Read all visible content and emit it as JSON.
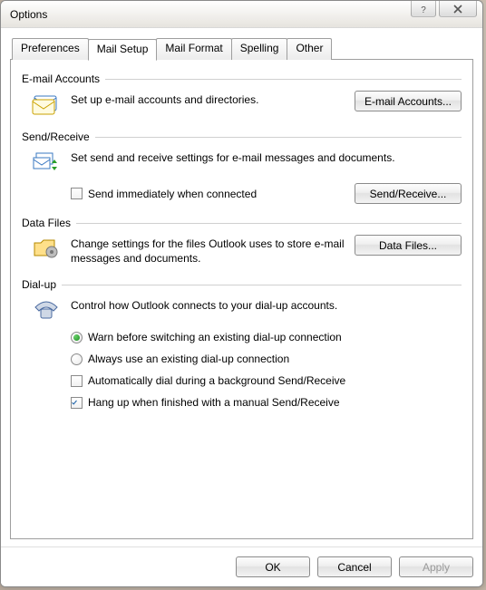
{
  "window": {
    "title": "Options"
  },
  "tabs": {
    "preferences": "Preferences",
    "mailsetup": "Mail Setup",
    "mailformat": "Mail Format",
    "spelling": "Spelling",
    "other": "Other"
  },
  "groups": {
    "email": {
      "title": "E-mail Accounts",
      "text": "Set up e-mail accounts and directories.",
      "button": "E-mail Accounts..."
    },
    "sendrecv": {
      "title": "Send/Receive",
      "text": "Set send and receive settings for e-mail messages and documents.",
      "check_immediate": "Send immediately when connected",
      "button": "Send/Receive..."
    },
    "datafiles": {
      "title": "Data Files",
      "text": "Change settings for the files Outlook uses to store e-mail messages and documents.",
      "button": "Data Files..."
    },
    "dialup": {
      "title": "Dial-up",
      "text": "Control how Outlook connects to your dial-up accounts.",
      "radio_warn": "Warn before switching an existing dial-up connection",
      "radio_always": "Always use an existing dial-up connection",
      "check_autodial": "Automatically dial during a background Send/Receive",
      "check_hangup": "Hang up when finished with a manual Send/Receive"
    }
  },
  "buttons": {
    "ok": "OK",
    "cancel": "Cancel",
    "apply": "Apply"
  },
  "state": {
    "send_immediately": false,
    "dialup_mode": "warn",
    "auto_dial": false,
    "hang_up": true
  }
}
